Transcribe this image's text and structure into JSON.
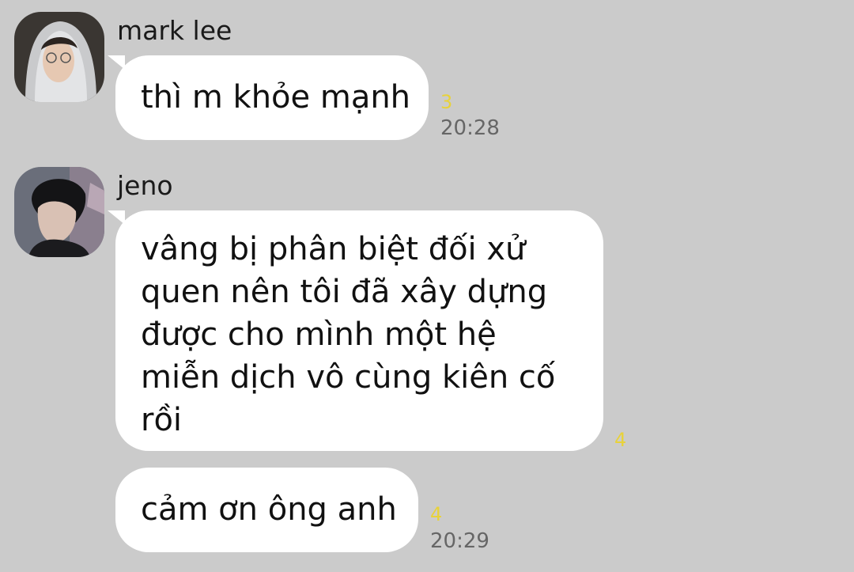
{
  "messages": [
    {
      "sender": "mark lee",
      "avatar": "mark-lee-avatar",
      "bubbles": [
        {
          "lines": [
            "thì m khỏe mạnh"
          ],
          "unread": "3",
          "time": "20:28"
        }
      ]
    },
    {
      "sender": "jeno",
      "avatar": "jeno-avatar",
      "bubbles": [
        {
          "lines": [
            "vâng bị phân biệt đối xử",
            "quen nên tôi đã xây dựng",
            "được cho mình một hệ",
            "miễn dịch vô cùng kiên cố",
            "rồi"
          ],
          "unread": "4",
          "time": ""
        },
        {
          "lines": [
            "cảm ơn ông anh"
          ],
          "unread": "4",
          "time": "20:29"
        }
      ]
    }
  ],
  "colors": {
    "background": "#cbcbcb",
    "bubble": "#ffffff",
    "unread": "#e8d23a",
    "time": "#666666"
  }
}
